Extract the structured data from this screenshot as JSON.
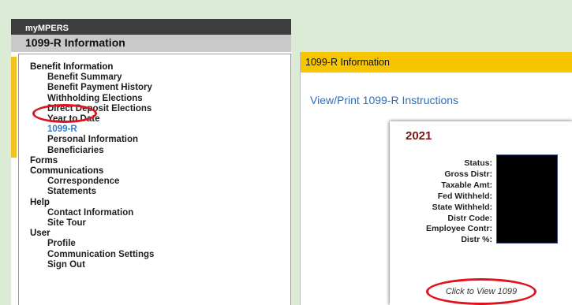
{
  "left": {
    "app_title": "myMPERS",
    "section_title": "1099-R Information",
    "nav": [
      {
        "label": "Benefit Information",
        "type": "group"
      },
      {
        "label": "Benefit Summary",
        "type": "item"
      },
      {
        "label": "Benefit Payment History",
        "type": "item"
      },
      {
        "label": "Withholding Elections",
        "type": "item"
      },
      {
        "label": "Direct Deposit Elections",
        "type": "item"
      },
      {
        "label": "Year to Date",
        "type": "item"
      },
      {
        "label": "1099-R",
        "type": "item",
        "active": true
      },
      {
        "label": "Personal Information",
        "type": "item"
      },
      {
        "label": "Beneficiaries",
        "type": "item"
      },
      {
        "label": "Forms",
        "type": "group"
      },
      {
        "label": "Communications",
        "type": "group"
      },
      {
        "label": "Correspondence",
        "type": "item"
      },
      {
        "label": "Statements",
        "type": "item"
      },
      {
        "label": "Help",
        "type": "group"
      },
      {
        "label": "Contact Information",
        "type": "item"
      },
      {
        "label": "Site Tour",
        "type": "item"
      },
      {
        "label": "User",
        "type": "group"
      },
      {
        "label": "Profile",
        "type": "item"
      },
      {
        "label": "Communication Settings",
        "type": "item"
      },
      {
        "label": "Sign Out",
        "type": "item"
      }
    ]
  },
  "right": {
    "header_title": "1099-R Information",
    "instructions_link": "View/Print 1099-R Instructions",
    "card": {
      "year": "2021",
      "fields": [
        "Status:",
        "Gross Distr:",
        "Taxable Amt:",
        "Fed Withheld:",
        "State Withheld:",
        "Distr Code:",
        "Employee Contr:",
        "Distr %:"
      ],
      "view_link": "Click to View 1099"
    }
  },
  "colors": {
    "accent_yellow": "#f8c600",
    "link_blue": "#2c6fc2",
    "highlight_red": "#e0131e",
    "year_red": "#7a1a12"
  }
}
